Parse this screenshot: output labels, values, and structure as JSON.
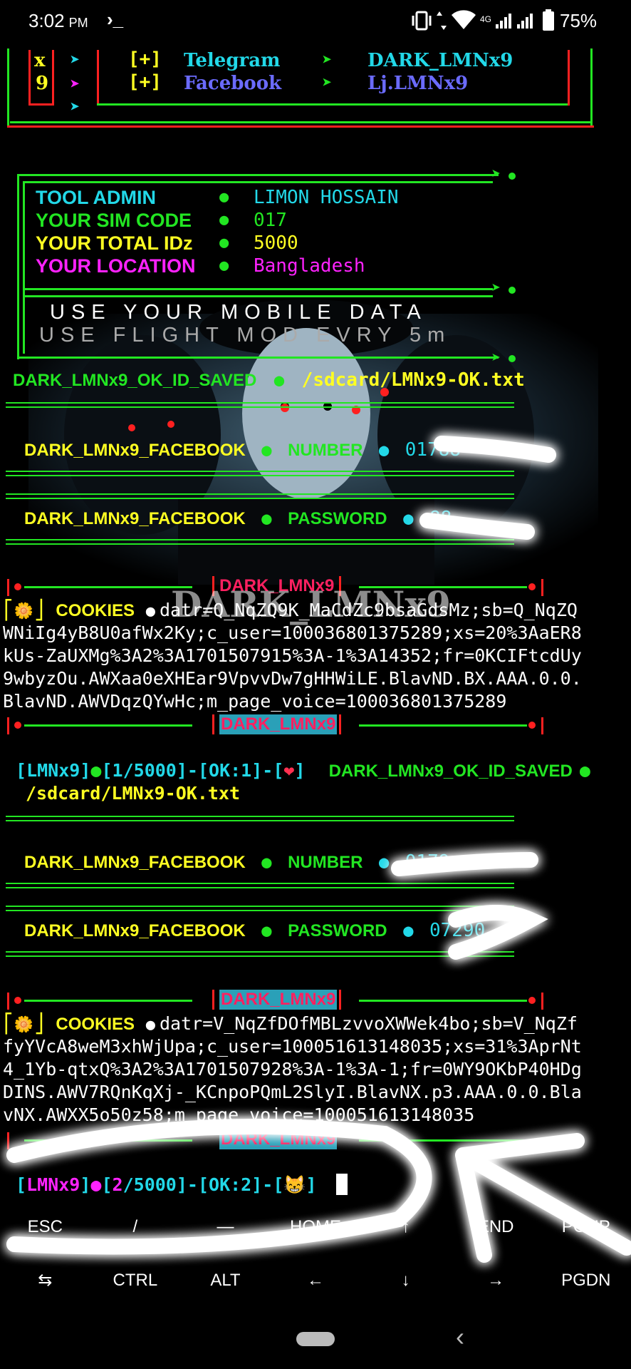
{
  "status_bar": {
    "time": "3:02",
    "ampm": "PM",
    "terminal_glyph": "›_",
    "network": "4G",
    "battery": "75%"
  },
  "top_box": {
    "side_a": "x",
    "side_b": "9",
    "rows": [
      {
        "prefix": "[+]",
        "label": "Telegram",
        "arrow": "➤",
        "value": "DARK_LMNx9"
      },
      {
        "prefix": "[+]",
        "label": "Facebook",
        "arrow": "➤",
        "value": "Lj.LMNx9"
      }
    ]
  },
  "info": [
    {
      "key": "TOOL ADMIN",
      "sep": "●",
      "value": "LIMON HOSSAIN"
    },
    {
      "key": "YOUR SIM CODE",
      "sep": "●",
      "value": "017"
    },
    {
      "key": "YOUR TOTAL IDz",
      "sep": "●",
      "value": "5000"
    },
    {
      "key": "YOUR LOCATION",
      "sep": "●",
      "value": "Bangladesh"
    }
  ],
  "notice": {
    "line1": "USE YOUR MOBILE DATA",
    "line2": "USE FLIGHT MOD EVRY 5m"
  },
  "saved_line": {
    "label": "DARK_LMNx9_OK_ID_SAVED",
    "sep": "●",
    "path": "/sdcard/LMNx9-OK.txt"
  },
  "result1": {
    "number": {
      "label": "DARK_LMNx9_FACEBOOK",
      "field": "NUMBER",
      "value": "01788"
    },
    "password": {
      "label": "DARK_LMNx9_FACEBOOK",
      "field": "PASSWORD",
      "value": "88"
    }
  },
  "banner": {
    "brand": "DARK_LMNx9",
    "watermark": "DARK_LMNx9"
  },
  "cookie1": {
    "label": "COOKIES",
    "icon": "🌼",
    "sep": "●",
    "lines": [
      "datr=Q_NqZQ9K_MaCdZc9bsaGdsMz;sb=Q_NqZQ",
      "WNiIg4yB8U0afWx2Ky;c_user=100036801375289;xs=20%3AaER8",
      "kUs-ZaUXMg%3A2%3A1701507915%3A-1%3A14352;fr=0KCIFtcdUy",
      "9wbyzOu.AWXaa0eXHEar9VpvvDw7gHHWiLE.BlavND.BX.AAA.0.0.",
      "BlavND.AWVDqzQYwHc;m_page_voice=100036801375289"
    ]
  },
  "progress1": {
    "tag": "LMNx9",
    "count": "1",
    "total": "5000",
    "ok": "OK:1",
    "emoji": "❤",
    "saved": "DARK_LMNx9_OK_ID_SAVED",
    "path": "/sdcard/LMNx9-OK.txt"
  },
  "result2": {
    "number": {
      "label": "DARK_LMNx9_FACEBOOK",
      "field": "NUMBER",
      "value": "0179"
    },
    "password": {
      "label": "DARK_LMNx9_FACEBOOK",
      "field": "PASSWORD",
      "value": "07290"
    }
  },
  "cookie2": {
    "label": "COOKIES",
    "icon": "🌼",
    "sep": "●",
    "lines": [
      "datr=V_NqZfDOfMBLzvvoXWWek4bo;sb=V_NqZf",
      "fyYVcA8weM3xhWjUpa;c_user=100051613148035;xs=31%3AprNt",
      "4_1Yb-qtxQ%3A2%3A1701507928%3A-1%3A-1;fr=0WY9OKbP40HDg",
      "DINS.AWV7RQnKqXj-_KCnpoPQmL2SlyI.BlavNX.p3.AAA.0.0.Bla",
      "vNX.AWXX5o50z58;m_page_voice=100051613148035"
    ]
  },
  "progress2": {
    "tag": "LMNx9",
    "count": "2",
    "total": "5000",
    "ok": "OK:2",
    "emoji": "😸"
  },
  "keyboard": {
    "row1": [
      "ESC",
      "/",
      "—",
      "HOME",
      "↑",
      "END",
      "PGUP"
    ],
    "row2": [
      "⇆",
      "CTRL",
      "ALT",
      "←",
      "↓",
      "→",
      "PGDN"
    ]
  },
  "nav": {
    "back": "‹"
  },
  "colors": {
    "green": "#22e622",
    "yellow": "#ffff22",
    "cyan": "#22d8e8",
    "magenta": "#ff22ff",
    "red": "#ff2020",
    "neon": "#ff00ff"
  }
}
